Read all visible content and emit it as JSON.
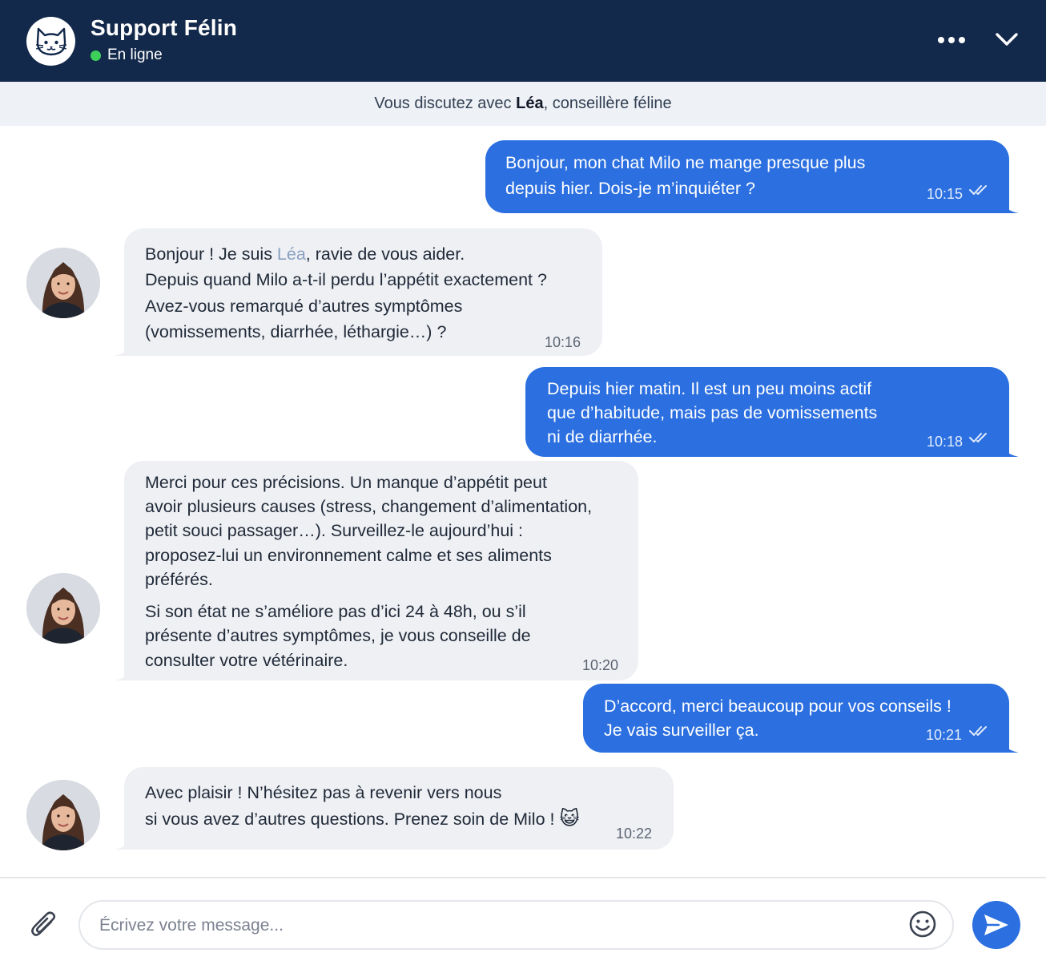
{
  "header": {
    "title": "Support Félin",
    "status": "En ligne",
    "status_color": "#3ecf5a",
    "background": "#13294b",
    "logo_icon": "cat-face-icon",
    "more_icon": "more-horizontal-icon",
    "collapse_icon": "chevron-down-icon"
  },
  "info_bar": {
    "prefix": "Vous discutez avec ",
    "agent_name": "Léa",
    "suffix": ", conseillère féline"
  },
  "messages": [
    {
      "direction": "outgoing",
      "lines": [
        "Bonjour, mon chat Milo ne mange presque plus",
        "depuis hier. Dois-je m’inquiéter ?"
      ],
      "time": "10:15",
      "read": true
    },
    {
      "direction": "incoming",
      "line1_prefix": "Bonjour ! Je suis ",
      "line1_name": "Léa",
      "line1_suffix": ", ravie de vous aider.",
      "lines": [
        "Depuis quand Milo a-t-il perdu l’appétit exactement ?",
        "Avez-vous remarqué d’autres symptômes",
        "(vomissements, diarrhée, léthargie…) ?"
      ],
      "time": "10:16"
    },
    {
      "direction": "outgoing",
      "lines": [
        "Depuis hier matin. Il est un peu moins actif",
        "que d’habitude, mais pas de vomissements",
        "ni de diarrhée."
      ],
      "time": "10:18",
      "read": true
    },
    {
      "direction": "incoming",
      "lines": [
        "Merci pour ces précisions. Un manque d’appétit peut",
        "avoir plusieurs causes (stress, changement d’alimentation,",
        "petit souci passager…). Surveillez-le aujourd’hui :",
        "proposez-lui un environnement calme et ses aliments",
        "préférés."
      ],
      "lines2": [
        "Si son état ne s’améliore pas d’ici 24 à 48h, ou s’il",
        "présente d’autres symptômes, je vous conseille de",
        "consulter votre vétérinaire."
      ],
      "time": "10:20"
    },
    {
      "direction": "outgoing",
      "lines": [
        "D’accord, merci beaucoup pour vos conseils !",
        "Je vais surveiller ça."
      ],
      "time": "10:21",
      "read": true
    },
    {
      "direction": "incoming",
      "lines": [
        "Avec plaisir ! N’hésitez pas à revenir vers nous",
        "si vous avez d’autres questions. Prenez soin de Milo !"
      ],
      "emoji": "😺",
      "time": "10:22"
    }
  ],
  "composer": {
    "placeholder": "Écrivez votre message...",
    "attach_icon": "paperclip-icon",
    "emoji_icon": "smiley-icon",
    "send_icon": "send-icon"
  },
  "colors": {
    "outgoing_bubble": "#2b6fe0",
    "incoming_bubble": "#eef0f4",
    "accent": "#2b6fe0"
  }
}
